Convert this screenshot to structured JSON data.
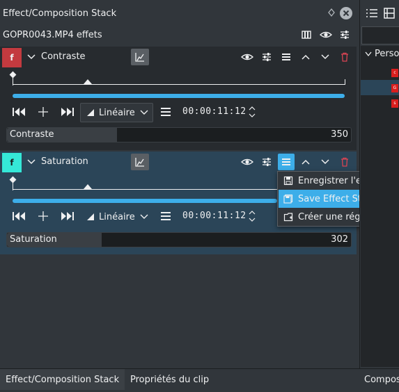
{
  "dock": {
    "title": "Effect/Composition Stack",
    "clip_label": "GOPR0043.MP4 effets"
  },
  "effects": [
    {
      "name": "Contraste",
      "badge": "f",
      "badge_color": "#c33a3f",
      "interpolation": "Linéaire",
      "timecode": "00:00:11:12",
      "param_label": "Contraste",
      "param_value": "350",
      "param_fill": 0.31
    },
    {
      "name": "Saturation",
      "badge": "f",
      "badge_color": "#35e8d8",
      "interpolation": "Linéaire",
      "timecode": "00:00:11:12",
      "param_label": "Saturation",
      "param_value": "302",
      "param_fill": 0.27
    }
  ],
  "menu": {
    "items": [
      {
        "label": "Enregistrer l'effet",
        "icon": "save-icon"
      },
      {
        "label": "Save Effect Stack",
        "icon": "save-stack-icon",
        "selected": true
      },
      {
        "label": "Créer une région",
        "icon": "create-region-icon"
      }
    ]
  },
  "right_panel": {
    "tree_label": "Perso",
    "chip_labels": [
      "c",
      "G",
      "s"
    ]
  },
  "tabs": [
    {
      "label": "Effect/Composition Stack",
      "active": true
    },
    {
      "label": "Propriétés du clip",
      "active": false
    },
    {
      "label": "Compos",
      "active": false
    }
  ],
  "colors": {
    "accent": "#3daee9",
    "background": "#31363b",
    "delete": "#da4453"
  }
}
